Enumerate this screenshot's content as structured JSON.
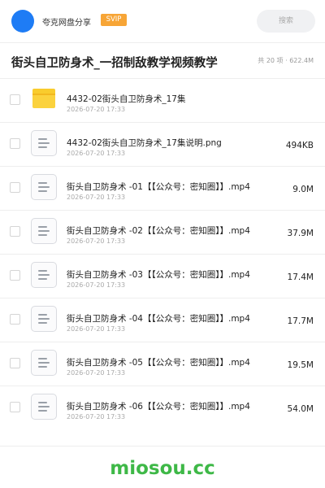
{
  "header": {
    "sharer_name": "夸克网盘分享",
    "badge": "SVIP",
    "search_placeholder": "搜索"
  },
  "share": {
    "title": "街头自卫防身术_一招制敌教学视频教学",
    "meta": "共 20 项 · 622.4M"
  },
  "files": [
    {
      "type": "folder",
      "icon": "folder-icon",
      "name": "4432-02街头自卫防身术_17集",
      "date": "2026-07-20 17:33",
      "size": ""
    },
    {
      "type": "file",
      "icon": "document-icon",
      "name": "4432-02街头自卫防身术_17集说明.png",
      "date": "2026-07-20 17:33",
      "size": "494KB"
    },
    {
      "type": "file",
      "icon": "document-icon",
      "name": "街头自卫防身术 -01【【公众号：密知圈】】.mp4",
      "date": "2026-07-20 17:33",
      "size": "9.0M"
    },
    {
      "type": "file",
      "icon": "document-icon",
      "name": "街头自卫防身术 -02【【公众号：密知圈】】.mp4",
      "date": "2026-07-20 17:33",
      "size": "37.9M"
    },
    {
      "type": "file",
      "icon": "document-icon",
      "name": "街头自卫防身术 -03【【公众号：密知圈】】.mp4",
      "date": "2026-07-20 17:33",
      "size": "17.4M"
    },
    {
      "type": "file",
      "icon": "document-icon",
      "name": "街头自卫防身术 -04【【公众号：密知圈】】.mp4",
      "date": "2026-07-20 17:33",
      "size": "17.7M"
    },
    {
      "type": "file",
      "icon": "document-icon",
      "name": "街头自卫防身术 -05【【公众号：密知圈】】.mp4",
      "date": "2026-07-20 17:33",
      "size": "19.5M"
    },
    {
      "type": "file",
      "icon": "document-icon",
      "name": "街头自卫防身术 -06【【公众号：密知圈】】.mp4",
      "date": "2026-07-20 17:33",
      "size": "54.0M"
    }
  ],
  "watermark": "miosou.cc",
  "colors": {
    "avatar": "#1e7cf5",
    "badge": "#f7a536",
    "folder": "#fbd23d",
    "watermark": "#3eb847"
  }
}
